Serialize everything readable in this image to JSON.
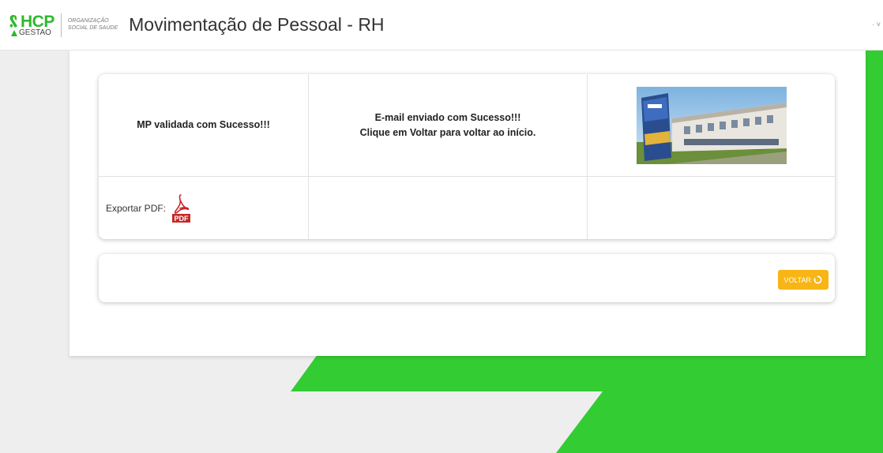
{
  "header": {
    "logo_text": "HCP",
    "logo_subtext": "GESTAO",
    "org_line1": "ORGANIZAÇÃO",
    "org_line2": "SOCIAL DE SAÚDE",
    "title": "Movimentação de Pessoal - RH",
    "right_text": "· ˅"
  },
  "main": {
    "validation_message": "MP validada com Sucesso!!!",
    "email_message_line1": "E-mail enviado com Sucesso!!!",
    "email_message_line2": "Clique em Voltar para voltar ao início.",
    "export_label": "Exportar PDF:",
    "pdf_icon_text": "PDF"
  },
  "actions": {
    "back_button_label": "VOLTAR"
  },
  "colors": {
    "brand_green": "#2eb82e",
    "background_green": "#33cc33",
    "button_yellow": "#f7b516",
    "pdf_red": "#c62828"
  },
  "icons": {
    "logo": "hcp-ribbon-icon",
    "pdf": "pdf-file-icon",
    "back": "refresh-icon"
  }
}
